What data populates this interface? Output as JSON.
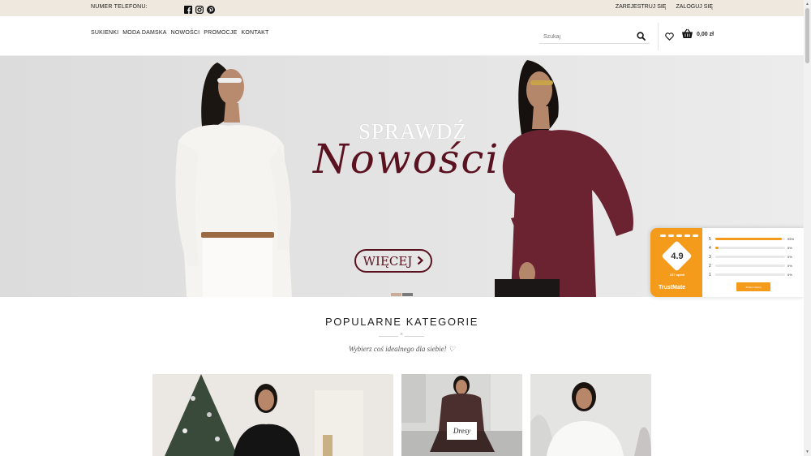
{
  "topbar": {
    "phone_label": "NUMER TELEFONU:",
    "social": [
      "facebook-icon",
      "instagram-icon",
      "pinterest-icon"
    ],
    "register": "ZAREJESTRUJ SIĘ",
    "login": "ZALOGUJ SIĘ"
  },
  "nav": {
    "items": [
      "SUKIENKI",
      "MODA DAMSKA",
      "NOWOŚCI",
      "PROMOCJE",
      "KONTAKT"
    ]
  },
  "search": {
    "placeholder": "Szukaj"
  },
  "cart": {
    "total": "0,00 zł"
  },
  "hero": {
    "headline_small": "SPRAWDŹ",
    "headline_big": "Nowości",
    "button": "WIĘCEJ",
    "slide_count": 2,
    "active_slide": 1
  },
  "trustmate": {
    "score": "4.9",
    "opinions": "137 opinii",
    "brand": "TrustMate",
    "ratings": [
      {
        "stars": "5",
        "share": 0.95,
        "pct": "95%"
      },
      {
        "stars": "4",
        "share": 0.05,
        "pct": "5%"
      },
      {
        "stars": "3",
        "share": 0,
        "pct": "0%"
      },
      {
        "stars": "2",
        "share": 0,
        "pct": "0%"
      },
      {
        "stars": "1",
        "share": 0,
        "pct": "0%"
      }
    ],
    "cta": "Zobacz więcej"
  },
  "categories": {
    "title": "POPULARNE KATEGORIE",
    "subtitle": "Wybierz coś idealnego dla siebie! ♡",
    "tiles": [
      "",
      "Dresy",
      ""
    ]
  },
  "colors": {
    "topbar_bg": "#efe8df",
    "accent_burgundy": "#5b1220",
    "trustmate_orange": "#f59b1c"
  }
}
